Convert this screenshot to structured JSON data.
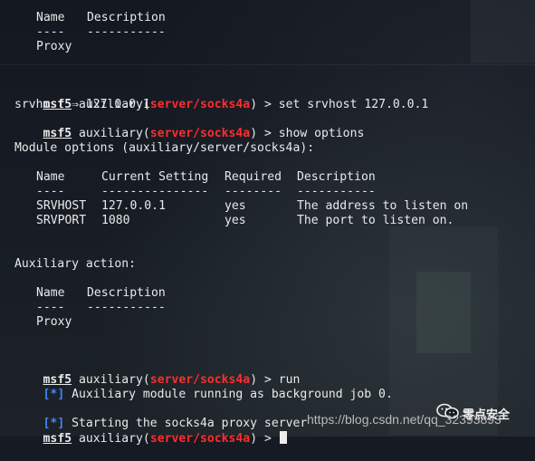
{
  "colors": {
    "background": "#161a22",
    "text": "#e9e9e9",
    "module": "#ff2d2d",
    "info_star": "#3f86ff"
  },
  "top_table": {
    "hdr_name": "Name",
    "hdr_desc": "Description",
    "sep_name": "----",
    "sep_desc": "-----------",
    "row_name": "Proxy"
  },
  "cmd1": {
    "prompt": "msf5",
    "pre": " auxiliary(",
    "module": "server/socks4a",
    "post": ") > ",
    "command": "set srvhost 127.0.0.1"
  },
  "out1": "srvhost ⇒ 127.0.0.1",
  "cmd2": {
    "prompt": "msf5",
    "pre": " auxiliary(",
    "module": "server/socks4a",
    "post": ") > ",
    "command": "show options"
  },
  "module_options_title": "Module options (auxiliary/server/socks4a):",
  "options_table": {
    "headers": [
      "Name",
      "Current Setting",
      "Required",
      "Description"
    ],
    "separators": [
      "----",
      "---------------",
      "--------",
      "-----------"
    ],
    "rows": [
      [
        "SRVHOST",
        "127.0.0.1",
        "yes",
        "The address to listen on"
      ],
      [
        "SRVPORT",
        "1080",
        "yes",
        "The port to listen on."
      ]
    ]
  },
  "aux_action_title": "Auxiliary action:",
  "action_table": {
    "hdr_name": "Name",
    "hdr_desc": "Description",
    "sep_name": "----",
    "sep_desc": "-----------",
    "row_name": "Proxy"
  },
  "cmd3": {
    "prompt": "msf5",
    "pre": " auxiliary(",
    "module": "server/socks4a",
    "post": ") > ",
    "command": "run"
  },
  "info1": {
    "star": "[*]",
    "text": " Auxiliary module running as background job 0."
  },
  "info2": {
    "star": "[*]",
    "text": " Starting the socks4a proxy server"
  },
  "cmd4": {
    "prompt": "msf5",
    "pre": " auxiliary(",
    "module": "server/socks4a",
    "post": ") > "
  },
  "watermark": {
    "name": "零点安全",
    "url": "https://blog.csdn.net/qq_32393893",
    "icon": "wechat-icon"
  }
}
